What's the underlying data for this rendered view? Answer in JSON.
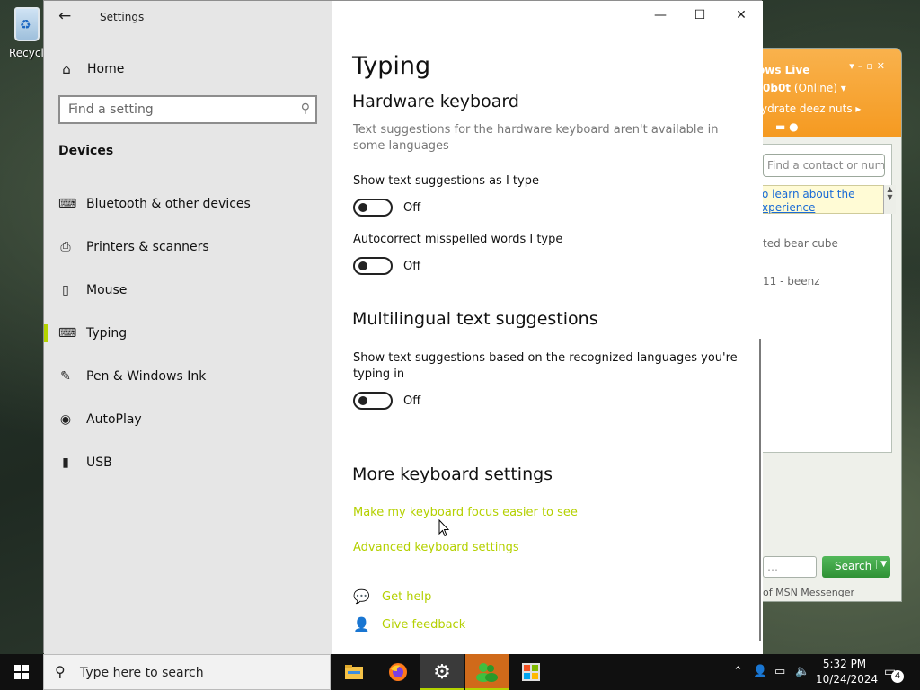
{
  "desktop": {
    "recycle_label": "Recycle"
  },
  "msn": {
    "title": "ows Live",
    "user": "0b0t",
    "status": "(Online)",
    "personal_msg": "ydrate deez nuts",
    "search_placeholder": "Find a contact or number",
    "notice_line1": "o learn about the",
    "notice_line2": "xperience",
    "contact1": "ted bear cube",
    "contact2": "11 - beenz",
    "search_button": "Search",
    "footer": "of MSN Messenger"
  },
  "settings": {
    "app_title": "Settings",
    "home_label": "Home",
    "find_placeholder": "Find a setting",
    "section": "Devices",
    "nav": [
      {
        "label": "Bluetooth & other devices",
        "icon": "bluetooth-devices-icon"
      },
      {
        "label": "Printers & scanners",
        "icon": "printer-icon"
      },
      {
        "label": "Mouse",
        "icon": "mouse-icon"
      },
      {
        "label": "Typing",
        "icon": "keyboard-icon",
        "active": true
      },
      {
        "label": "Pen & Windows Ink",
        "icon": "pen-icon"
      },
      {
        "label": "AutoPlay",
        "icon": "autoplay-icon"
      },
      {
        "label": "USB",
        "icon": "usb-icon"
      }
    ],
    "page_title": "Typing",
    "hardware": {
      "heading": "Hardware keyboard",
      "description": "Text suggestions for the hardware keyboard aren't available in some languages",
      "show_suggestions_label": "Show text suggestions as I type",
      "show_suggestions_state": "Off",
      "autocorrect_label": "Autocorrect misspelled words I type",
      "autocorrect_state": "Off"
    },
    "multilingual": {
      "heading": "Multilingual text suggestions",
      "label": "Show text suggestions based on the recognized languages you're typing in",
      "state": "Off"
    },
    "more": {
      "heading": "More keyboard settings",
      "link1": "Make my keyboard focus easier to see",
      "link2": "Advanced keyboard settings"
    },
    "help": {
      "get_help": "Get help",
      "give_feedback": "Give feedback"
    }
  },
  "taskbar": {
    "search_placeholder": "Type here to search",
    "time": "5:32 PM",
    "date": "10/24/2024",
    "notification_count": "4",
    "accent": "#b4d300"
  }
}
